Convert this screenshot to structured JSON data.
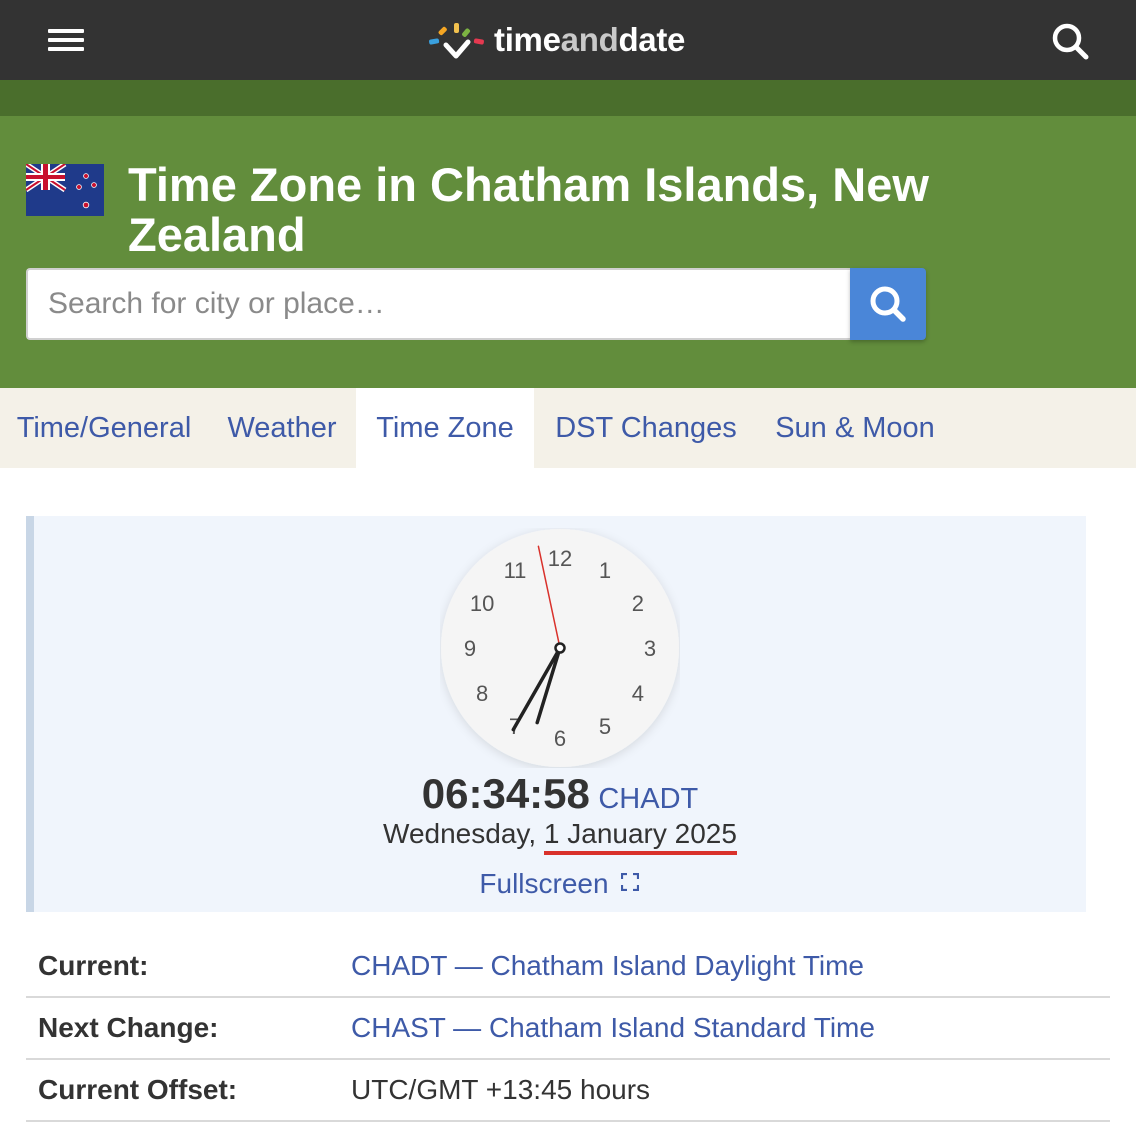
{
  "header": {
    "menu_icon": "hamburger-menu-icon",
    "logo_text_a": "time",
    "logo_text_b": "and",
    "logo_text_c": "date",
    "search_icon": "search-icon"
  },
  "hero": {
    "flag": "new-zealand-flag",
    "title": "Time Zone in Chatham Islands, New Zealand",
    "search_placeholder": "Search for city or place…",
    "search_button_icon": "search-icon"
  },
  "tabs": [
    {
      "label": "Time/General",
      "active": false
    },
    {
      "label": "Weather",
      "active": false
    },
    {
      "label": "Time Zone",
      "active": true
    },
    {
      "label": "DST Changes",
      "active": false
    },
    {
      "label": "Sun & Moon",
      "active": false
    }
  ],
  "clock": {
    "numerals": [
      "12",
      "1",
      "2",
      "3",
      "4",
      "5",
      "6",
      "7",
      "8",
      "9",
      "10",
      "11"
    ],
    "hour": 6,
    "minute": 34,
    "second": 58,
    "time_text": "06:34:58",
    "tz_abbr": "CHADT",
    "weekday": "Wednesday,",
    "date": "1 January 2025",
    "fullscreen_label": "Fullscreen",
    "fullscreen_icon": "fullscreen-icon",
    "colors": {
      "second_hand": "#d9312b",
      "hands": "#222222"
    }
  },
  "info": [
    {
      "label": "Current:",
      "value": "CHADT — Chatham Island Daylight Time",
      "link": true
    },
    {
      "label": "Next Change:",
      "value": "CHAST — Chatham Island Standard Time",
      "link": true
    },
    {
      "label": "Current Offset:",
      "value": "UTC/GMT +13:45 hours",
      "link": false
    }
  ],
  "colors": {
    "topbar": "#333333",
    "hero_green": "#628d3c",
    "link_blue": "#3e5aa8",
    "search_button": "#4a86d8"
  }
}
